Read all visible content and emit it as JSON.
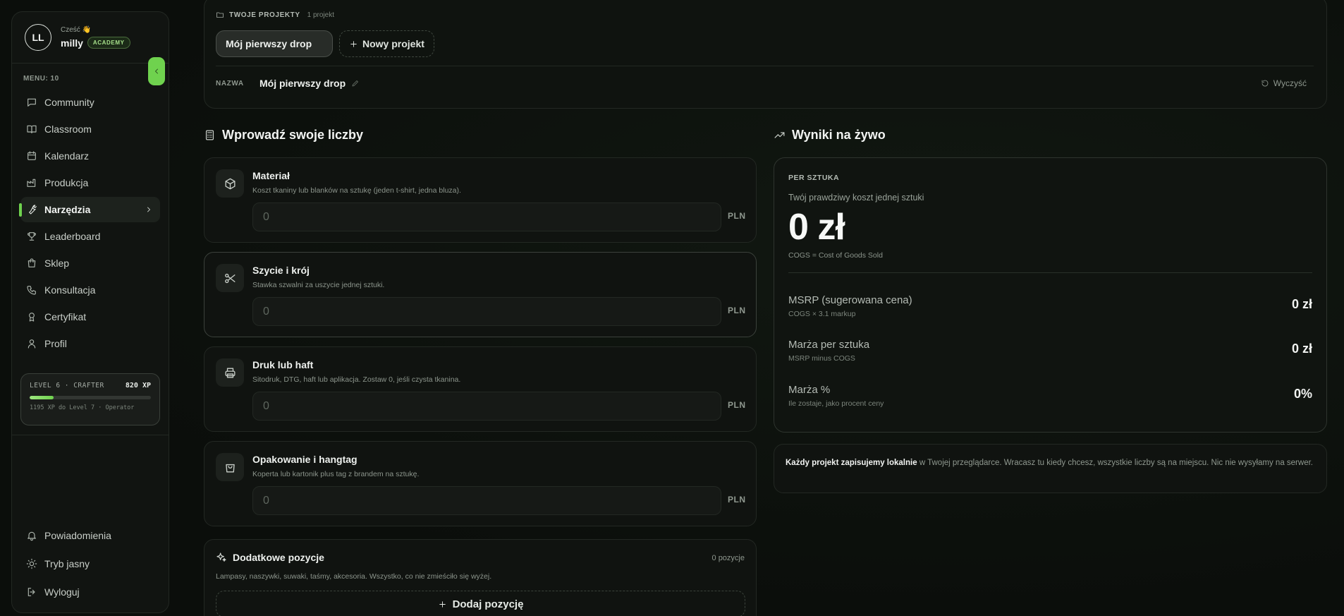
{
  "sidebar": {
    "avatar_initials": "LL",
    "greeting": "Cześć 👋",
    "username": "milly",
    "badge": "ACADEMY",
    "menu_title": "MENU: 10",
    "items": [
      {
        "label": "Community",
        "icon": "chat-icon"
      },
      {
        "label": "Classroom",
        "icon": "book-icon"
      },
      {
        "label": "Kalendarz",
        "icon": "calendar-icon"
      },
      {
        "label": "Produkcja",
        "icon": "factory-icon"
      },
      {
        "label": "Narzędzia",
        "icon": "wrench-icon",
        "active": true
      },
      {
        "label": "Leaderboard",
        "icon": "trophy-icon"
      },
      {
        "label": "Sklep",
        "icon": "shopping-bag-icon"
      },
      {
        "label": "Konsultacja",
        "icon": "phone-icon"
      },
      {
        "label": "Certyfikat",
        "icon": "award-icon"
      },
      {
        "label": "Profil",
        "icon": "user-icon"
      }
    ],
    "level": {
      "name": "LEVEL 6 · CRAFTER",
      "xp": "820 XP",
      "progress": 0.2,
      "next": "1195 XP do Level 7 · Operator"
    },
    "bottom": [
      {
        "label": "Powiadomienia",
        "icon": "bell-icon"
      },
      {
        "label": "Tryb jasny",
        "icon": "sun-icon"
      },
      {
        "label": "Wyloguj",
        "icon": "logout-icon"
      }
    ],
    "accent": "#6fd24e"
  },
  "projects": {
    "label": "TWOJE PROJEKTY",
    "count": "1 projekt",
    "items": [
      "Mój pierwszy drop"
    ],
    "new_label": "Nowy projekt",
    "name_label": "NAZWA",
    "name_value": "Mój pierwszy drop",
    "clear_label": "Wyczyść"
  },
  "inputs": {
    "heading": "Wprowadź swoje liczby",
    "costs": [
      {
        "title": "Materiał",
        "desc": "Koszt tkaniny lub blanków na sztukę (jeden t-shirt, jedna bluza).",
        "placeholder": "0",
        "currency": "PLN",
        "icon": "box-icon"
      },
      {
        "title": "Szycie i krój",
        "desc": "Stawka szwalni za uszycie jednej sztuki.",
        "placeholder": "0",
        "currency": "PLN",
        "icon": "scissors-icon"
      },
      {
        "title": "Druk lub haft",
        "desc": "Sitodruk, DTG, haft lub aplikacja. Zostaw 0, jeśli czysta tkanina.",
        "placeholder": "0",
        "currency": "PLN",
        "icon": "printer-icon"
      },
      {
        "title": "Opakowanie i hangtag",
        "desc": "Koperta lub kartonik plus tag z brandem na sztukę.",
        "placeholder": "0",
        "currency": "PLN",
        "icon": "shopping-bag-icon"
      }
    ],
    "extra": {
      "title": "Dodatkowe pozycje",
      "count": "0 pozycje",
      "desc": "Lampasy, naszywki, suwaki, taśmy, akcesoria. Wszystko, co nie zmieściło się wyżej.",
      "add_label": "Dodaj pozycję"
    }
  },
  "results": {
    "heading": "Wyniki na żywo",
    "per_label": "PER SZTUKA",
    "true_cost_label": "Twój prawdziwy koszt jednej sztuki",
    "cost_value": "0 zł",
    "cogs_note": "COGS = Cost of Goods Sold",
    "rows": [
      {
        "label": "MSRP (sugerowana cena)",
        "sub": "COGS × 3.1 markup",
        "value": "0 zł"
      },
      {
        "label": "Marża per sztuka",
        "sub": "MSRP minus COGS",
        "value": "0 zł"
      },
      {
        "label": "Marża %",
        "sub": "Ile zostaje, jako procent ceny",
        "value": "0%"
      }
    ]
  },
  "info": {
    "bold": "Każdy projekt zapisujemy lokalnie",
    "text": " w Twojej przeglądarce. Wracasz tu kiedy chcesz, wszystkie liczby są na miejscu. Nic nie wysyłamy na serwer."
  }
}
